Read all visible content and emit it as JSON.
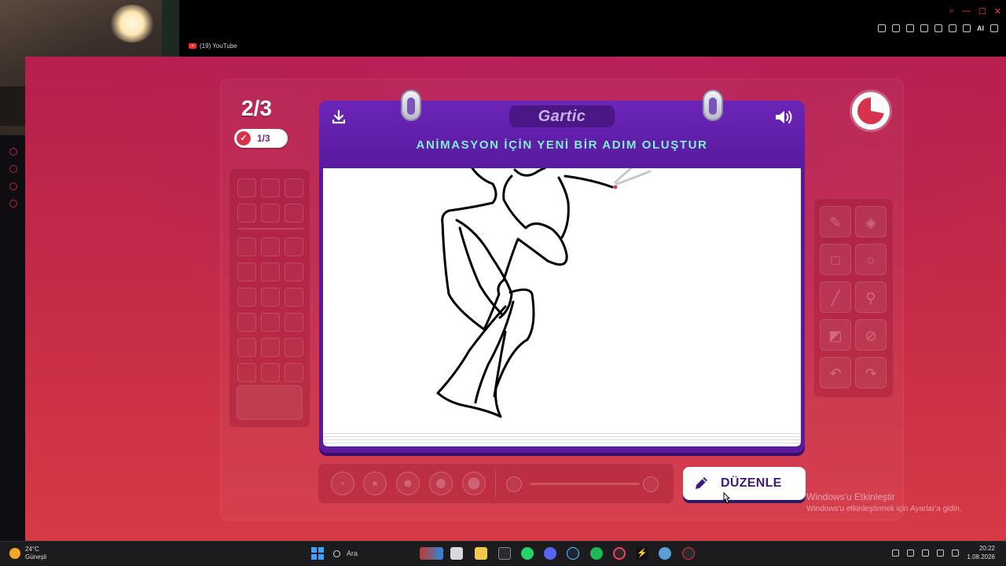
{
  "browser": {
    "tab_title": "(19) YouTube",
    "ai_label": "AI"
  },
  "game": {
    "round": "2/3",
    "turn": "1/3",
    "logo": "Gartic",
    "instruction": "ANİMASYON İÇİN YENİ BİR ADIM OLUŞTUR",
    "edit_button": "DÜZENLE",
    "timer_remaining_fraction": 0.72
  },
  "windows": {
    "activate_title": "Windows'u Etkinleştir",
    "activate_sub": "Windows'u etkinleştirmek için Ayarlar'a gidin."
  },
  "taskbar": {
    "weather_temp": "24°C",
    "weather_desc": "Güneşli",
    "search_placeholder": "Ara",
    "time": "20:22",
    "date": "1.08.2026"
  },
  "colors": {
    "accent_purple": "#5a1a9a",
    "instruction_teal": "#7ef0d6",
    "background_red": "#c42a48"
  }
}
